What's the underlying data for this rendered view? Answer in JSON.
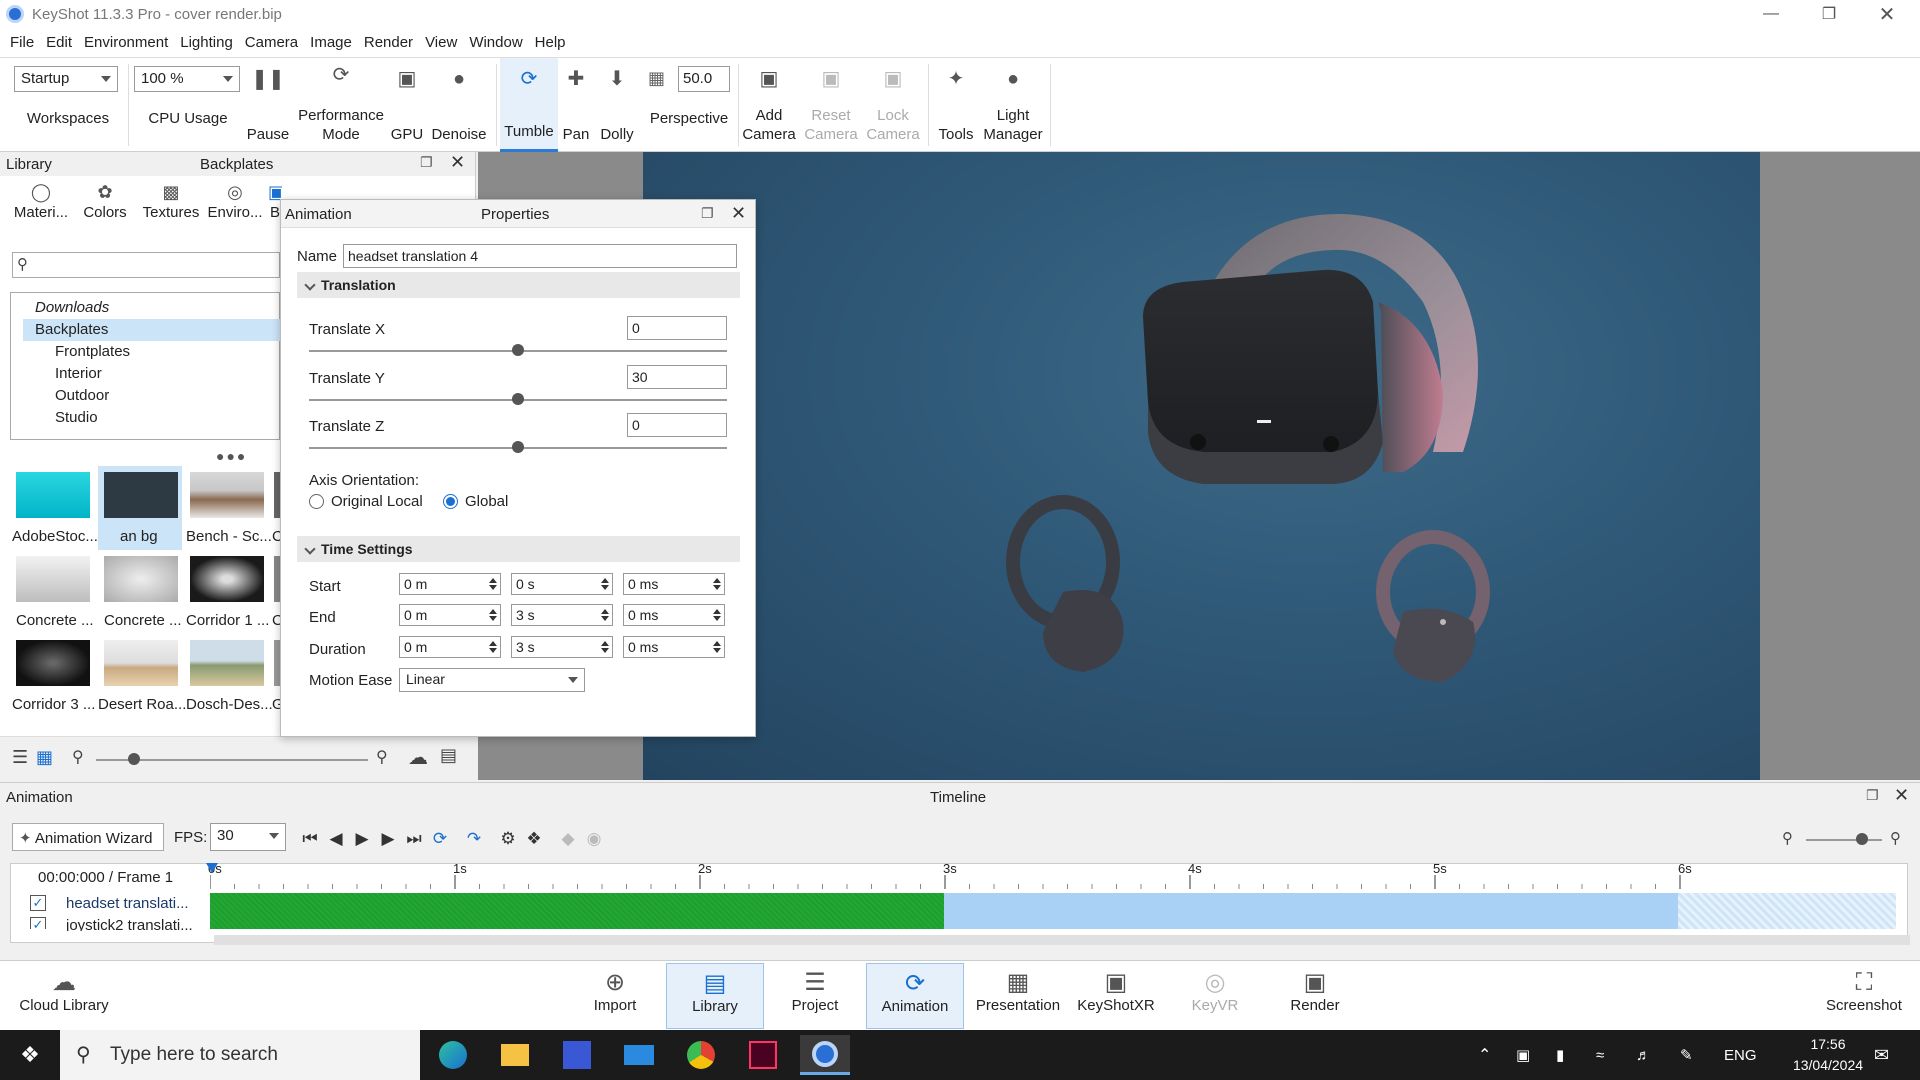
{
  "window": {
    "title": "KeyShot 11.3.3 Pro  - cover render.bip",
    "minimize_icon": "minimize-icon",
    "restore_icon": "restore-icon",
    "close_icon": "close-icon"
  },
  "menu": [
    "File",
    "Edit",
    "Environment",
    "Lighting",
    "Camera",
    "Image",
    "Render",
    "View",
    "Window",
    "Help"
  ],
  "ribbon": {
    "workspace_value": "Startup",
    "workspaces_label": "Workspaces",
    "cpu_value": "100 %",
    "cpu_label": "CPU Usage",
    "pause_label": "Pause",
    "performance_label_1": "Performance",
    "performance_label_2": "Mode",
    "gpu_label": "GPU",
    "denoise_label": "Denoise",
    "tumble_label": "Tumble",
    "pan_label": "Pan",
    "dolly_label": "Dolly",
    "perspective_value": "50.0",
    "perspective_label": "Perspective",
    "add_camera_1": "Add",
    "add_camera_2": "Camera",
    "reset_camera_1": "Reset",
    "reset_camera_2": "Camera",
    "lock_camera_1": "Lock",
    "lock_camera_2": "Camera",
    "tools_label": "Tools",
    "light_manager_1": "Light",
    "light_manager_2": "Manager"
  },
  "library": {
    "title": "Library",
    "section": "Backplates",
    "tabs": [
      "Materi...",
      "Colors",
      "Textures",
      "Enviro...",
      "B"
    ],
    "tree": {
      "downloads": "Downloads",
      "backplates": "Backplates",
      "children": [
        "Frontplates",
        "Interior",
        "Outdoor",
        "Studio"
      ]
    },
    "thumbs_row1": [
      "AdobeStoc...",
      "an bg",
      "Bench - Sc...",
      "C"
    ],
    "thumbs_row2": [
      "Concrete ...",
      "Concrete ...",
      "Corridor 1 ...",
      "C"
    ],
    "thumbs_row3": [
      "Corridor 3 ...",
      "Desert Roa...",
      "Dosch-Des...",
      "G"
    ]
  },
  "properties": {
    "tab_left": "Animation",
    "title": "Properties",
    "name_label": "Name",
    "name_value": "headset translation 4",
    "translation_section": "Translation",
    "translate_x_label": "Translate X",
    "translate_x_value": "0",
    "translate_y_label": "Translate Y",
    "translate_y_value": "30",
    "translate_z_label": "Translate Z",
    "translate_z_value": "0",
    "axis_label": "Axis Orientation:",
    "axis_option_1": "Original Local",
    "axis_option_2": "Global",
    "time_section": "Time Settings",
    "start_label": "Start",
    "end_label": "End",
    "duration_label": "Duration",
    "start": [
      "0 m",
      "0 s",
      "0 ms"
    ],
    "end": [
      "0 m",
      "3 s",
      "0 ms"
    ],
    "duration": [
      "0 m",
      "3 s",
      "0 ms"
    ],
    "motion_ease_label": "Motion Ease",
    "motion_ease_value": "Linear"
  },
  "animation": {
    "panel_left": "Animation",
    "panel_title": "Timeline",
    "wizard_label": "Animation Wizard",
    "fps_label": "FPS:",
    "fps_value": "30",
    "time_readout": "00:00:000 / Frame 1",
    "ruler": [
      "0s",
      "1s",
      "2s",
      "3s",
      "4s",
      "5s",
      "6s"
    ],
    "tracks": [
      "headset translati...",
      "joystick2 translati..."
    ]
  },
  "bottombar": {
    "cloud_library": "Cloud Library",
    "import": "Import",
    "library": "Library",
    "project": "Project",
    "animation": "Animation",
    "presentation": "Presentation",
    "keyshotxr": "KeyShotXR",
    "keyvr": "KeyVR",
    "render": "Render",
    "screenshot": "Screenshot"
  },
  "taskbar": {
    "search_placeholder": "Type here to search",
    "language": "ENG",
    "time": "17:56",
    "date": "13/04/2024"
  },
  "colors": {
    "accent": "#1a6fd0",
    "track_green": "#1f9e2f",
    "track_blue": "#a8d1f5",
    "render_bg": "#2f5877"
  }
}
